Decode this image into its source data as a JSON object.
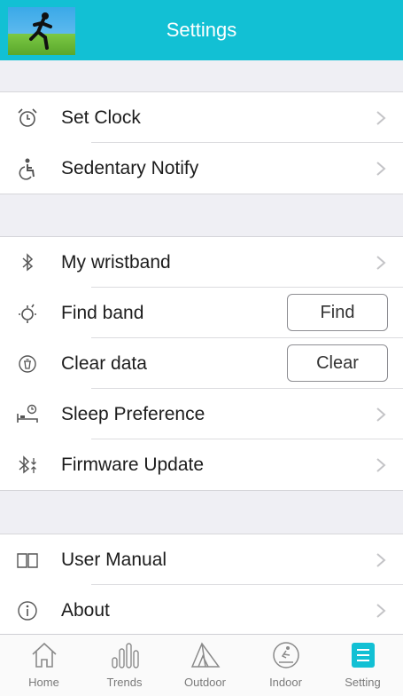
{
  "header": {
    "title": "Settings"
  },
  "groups": [
    {
      "items": [
        {
          "label": "Set Clock",
          "icon": "alarm-clock-icon"
        },
        {
          "label": "Sedentary Notify",
          "icon": "sedentary-person-icon"
        }
      ]
    },
    {
      "items": [
        {
          "label": "My wristband",
          "icon": "bluetooth-icon"
        },
        {
          "label": "Find band",
          "icon": "find-band-icon",
          "button": "Find"
        },
        {
          "label": "Clear data",
          "icon": "trash-circle-icon",
          "button": "Clear"
        },
        {
          "label": "Sleep Preference",
          "icon": "sleep-bed-icon"
        },
        {
          "label": "Firmware Update",
          "icon": "bluetooth-update-icon"
        }
      ]
    },
    {
      "items": [
        {
          "label": "User Manual",
          "icon": "book-icon"
        },
        {
          "label": "About",
          "icon": "info-icon"
        }
      ]
    }
  ],
  "tabs": [
    {
      "label": "Home",
      "icon": "home-icon"
    },
    {
      "label": "Trends",
      "icon": "trends-bars-icon"
    },
    {
      "label": "Outdoor",
      "icon": "outdoor-tent-icon"
    },
    {
      "label": "Indoor",
      "icon": "indoor-treadmill-icon"
    },
    {
      "label": "Setting",
      "icon": "settings-list-icon",
      "active": true
    }
  ],
  "colors": {
    "header": "#12c0d4",
    "active_tab": "#12c0d4",
    "background": "#efeff4"
  }
}
